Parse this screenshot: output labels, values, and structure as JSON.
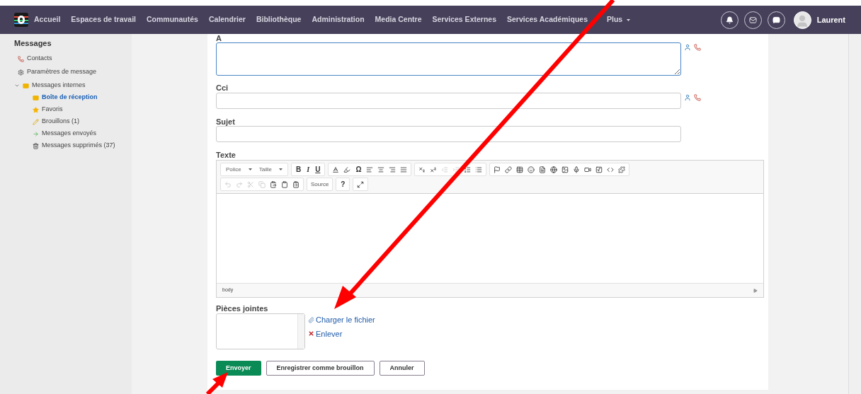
{
  "nav": {
    "items": [
      "Accueil",
      "Espaces de travail",
      "Communautés",
      "Calendrier",
      "Bibliothèque",
      "Administration",
      "Media Centre",
      "Services Externes",
      "Services Académiques"
    ],
    "more": "Plus",
    "user": "Laurent"
  },
  "sidebar": {
    "title": "Messages",
    "items": [
      {
        "label": "Contacts",
        "selected": false
      },
      {
        "label": "Paramètres de message",
        "selected": false
      },
      {
        "label": "Messages internes",
        "selected": false,
        "expanded": true,
        "children": [
          {
            "label": "Boîte de réception",
            "selected": true
          },
          {
            "label": "Favoris",
            "selected": false
          },
          {
            "label": "Brouillons (1)",
            "selected": false
          },
          {
            "label": "Messages envoyés",
            "selected": false
          },
          {
            "label": "Messages supprimés (37)",
            "selected": false
          }
        ]
      }
    ]
  },
  "form": {
    "to_label": "A",
    "bcc_label": "Cci",
    "subject_label": "Sujet",
    "text_label": "Texte",
    "toolbar": [
      [
        [
          {
            "kind": "select",
            "label": "Police"
          },
          {
            "kind": "select",
            "label": "Taille"
          }
        ],
        [
          {
            "kind": "bold",
            "label": "B"
          },
          {
            "kind": "italic",
            "label": "I"
          },
          {
            "kind": "underline",
            "label": "U"
          }
        ],
        [
          {
            "kind": "icon",
            "disabled": false
          },
          {
            "kind": "icon",
            "disabled": false
          },
          {
            "kind": "letter",
            "label": "Ω"
          },
          {
            "kind": "icon",
            "disabled": false
          },
          {
            "kind": "icon",
            "disabled": false
          },
          {
            "kind": "icon",
            "disabled": false
          },
          {
            "kind": "icon",
            "disabled": false
          }
        ],
        [
          {
            "kind": "icon",
            "disabled": false
          },
          {
            "kind": "icon",
            "disabled": false
          },
          {
            "kind": "icon",
            "disabled": true
          },
          {
            "kind": "icon",
            "disabled": true
          },
          {
            "kind": "icon",
            "disabled": false
          },
          {
            "kind": "icon",
            "disabled": false
          }
        ],
        [
          {
            "kind": "icon",
            "disabled": false
          },
          {
            "kind": "icon",
            "disabled": false
          },
          {
            "kind": "icon",
            "disabled": false
          },
          {
            "kind": "icon",
            "disabled": false
          },
          {
            "kind": "icon",
            "disabled": false
          },
          {
            "kind": "icon",
            "disabled": false
          },
          {
            "kind": "icon",
            "disabled": false
          },
          {
            "kind": "icon",
            "disabled": false
          },
          {
            "kind": "icon",
            "disabled": false
          },
          {
            "kind": "icon",
            "disabled": false
          },
          {
            "kind": "icon",
            "disabled": false
          },
          {
            "kind": "icon",
            "disabled": false
          }
        ]
      ],
      [
        [
          {
            "kind": "icon",
            "disabled": true
          },
          {
            "kind": "icon",
            "disabled": true
          },
          {
            "kind": "icon",
            "disabled": true
          },
          {
            "kind": "icon",
            "disabled": true
          },
          {
            "kind": "icon",
            "disabled": false
          },
          {
            "kind": "icon",
            "disabled": false
          },
          {
            "kind": "icon",
            "disabled": false
          }
        ],
        [
          {
            "kind": "text",
            "label": "Source"
          }
        ],
        [
          {
            "kind": "letter",
            "label": "?"
          }
        ],
        [
          {
            "kind": "icon",
            "disabled": false
          }
        ]
      ]
    ],
    "editor_path": "body",
    "attachments_label": "Pièces jointes",
    "upload_link": "Charger le fichier",
    "remove_link": "Enlever",
    "buttons": [
      {
        "label": "Envoyer",
        "kind": "primary"
      },
      {
        "label": "Enregistrer comme brouillon",
        "kind": "secondary"
      },
      {
        "label": "Annuler",
        "kind": "secondary"
      }
    ]
  }
}
